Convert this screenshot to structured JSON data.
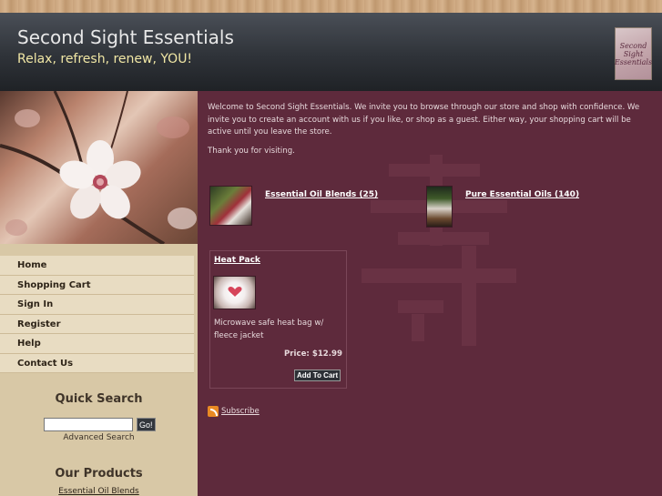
{
  "header": {
    "title": "Second Sight Essentials",
    "tagline": "Relax, refresh, renew, YOU!",
    "logo_text": [
      "Second",
      "Sight",
      "Essentials"
    ]
  },
  "nav": {
    "items": [
      "Home",
      "Shopping Cart",
      "Sign In",
      "Register",
      "Help",
      "Contact Us"
    ]
  },
  "quick_search": {
    "title": "Quick Search",
    "go_label": "Go!",
    "advanced_label": "Advanced Search"
  },
  "our_products": {
    "title": "Our Products",
    "first_link": "Essential Oil Blends"
  },
  "main": {
    "welcome": "Welcome to Second Sight Essentials. We invite you to browse through our store and shop with confidence. We invite you to create an account with us if you like, or shop as a guest. Either way, your shopping cart will be active until you leave the store.",
    "thanks": "Thank you for visiting.",
    "categories": [
      {
        "label": "Essential Oil Blends (25)"
      },
      {
        "label": "Pure Essential Oils (140)"
      }
    ],
    "product": {
      "name": "Heat Pack",
      "description": "Microwave safe heat bag w/ fleece jacket",
      "price": "Price: $12.99",
      "add_label": "Add To Cart"
    },
    "subscribe_label": "Subscribe"
  },
  "colors": {
    "main_bg": "#5e2a3c",
    "sidebar_bg": "#d8c8a6",
    "header_bg": "#2f3339",
    "tagline": "#f1e7a5"
  }
}
